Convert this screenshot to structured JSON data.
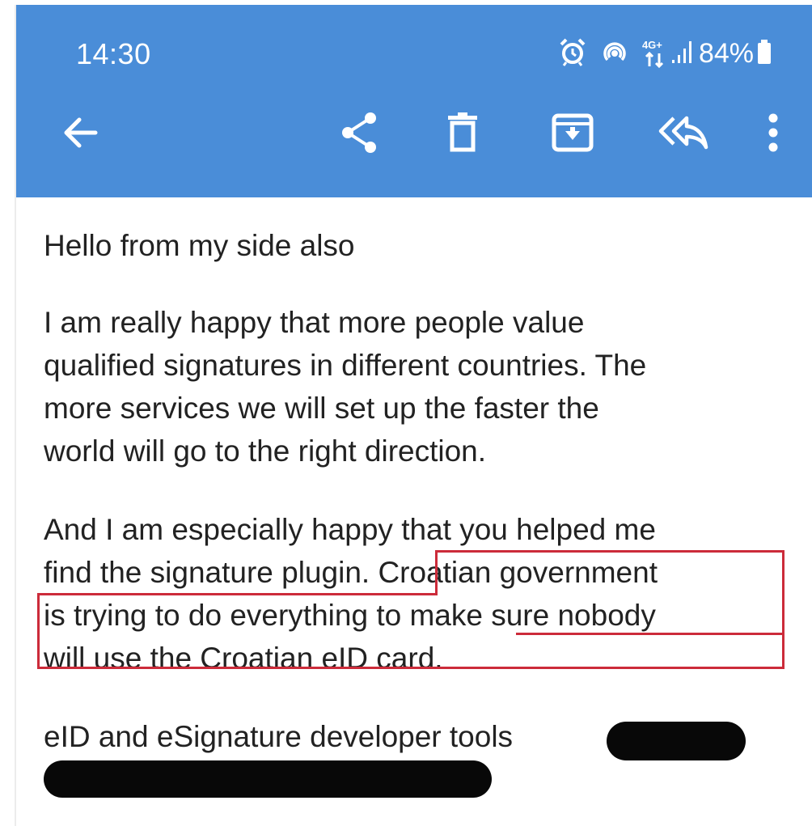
{
  "status_bar": {
    "time": "14:30",
    "network": "4G+",
    "battery_percent": "84%",
    "icons": [
      "alarm-icon",
      "hotspot-icon",
      "network-4g-icon",
      "signal-icon",
      "battery-icon"
    ]
  },
  "toolbar": {
    "icons": [
      "back-arrow-icon",
      "share-icon",
      "delete-icon",
      "archive-icon",
      "reply-all-icon",
      "more-vert-icon"
    ]
  },
  "email": {
    "greeting": "Hello from my side also",
    "paragraph1_lines": [
      "I am really happy that more people value",
      "qualified signatures in different countries. The",
      "more services we will set up the faster the",
      "world will go to the right direction."
    ],
    "paragraph2_lines": [
      "And I am especially happy that you helped me",
      "find the signature plugin. Croatian government",
      "is trying to do everything to make sure nobody",
      "will use the Croatian eID card."
    ],
    "signature_line": "eID and eSignature developer tools"
  },
  "colors": {
    "app_bar": "#4a8dd8",
    "text": "#222222",
    "highlight_border": "#cc2b3a",
    "redaction": "#080808"
  }
}
